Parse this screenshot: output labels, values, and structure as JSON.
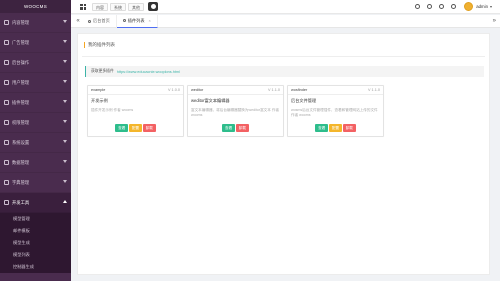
{
  "sidebar": {
    "logo": "WOOCMS",
    "items": [
      {
        "label": "内容管理",
        "open": false
      },
      {
        "label": "广告管理",
        "open": false
      },
      {
        "label": "后台操作",
        "open": false
      },
      {
        "label": "用户管理",
        "open": false
      },
      {
        "label": "插件管理",
        "open": false
      },
      {
        "label": "权限管理",
        "open": false
      },
      {
        "label": "系统设置",
        "open": false
      },
      {
        "label": "数据管理",
        "open": false
      },
      {
        "label": "字典管理",
        "open": false
      },
      {
        "label": "开发工具",
        "open": true
      }
    ],
    "sub_items": [
      "模型管理",
      "邮件模板",
      "模型生成",
      "模型列表",
      "控制器生成"
    ]
  },
  "topbar": {
    "tabs": [
      "内容",
      "系统",
      "其他"
    ],
    "username": "admin"
  },
  "tabsbar": {
    "tabs": [
      {
        "label": "后台首页",
        "active": false
      },
      {
        "label": "插件列表",
        "active": true
      }
    ]
  },
  "main": {
    "title": "我的插件列表",
    "notice_label": "获取更多插件",
    "notice_url": "https://www.educacnie.wooplons.html",
    "cards": [
      {
        "name": "example",
        "version": "V 1.0.0",
        "title": "开发示例",
        "desc": "插件开发示例 作者 wooms",
        "buttons": [
          "查看",
          "配置",
          "卸载"
        ]
      },
      {
        "name": "weditor",
        "version": "V 1.1.0",
        "title": "weditor富文本编辑器",
        "desc": "富文本编辑器，将后台编辑器替换为weditor富文本 作者 wooms",
        "buttons": [
          "查看",
          "卸载"
        ]
      },
      {
        "name": "wosfinder",
        "version": "V 1.1.0",
        "title": "后台文件管理",
        "desc": "wosms后台文件管理插件，查看和管理网站上传的文件 作者 wooms",
        "buttons": [
          "查看",
          "配置",
          "卸载"
        ]
      }
    ]
  },
  "colors": {
    "sidebar_bg": "#4a2c4e",
    "accent_orange": "#f5a623",
    "accent_teal": "#3cb4a8",
    "btn_green": "#2ebd8c",
    "btn_yellow": "#f4b62c",
    "btn_red": "#f36163"
  }
}
